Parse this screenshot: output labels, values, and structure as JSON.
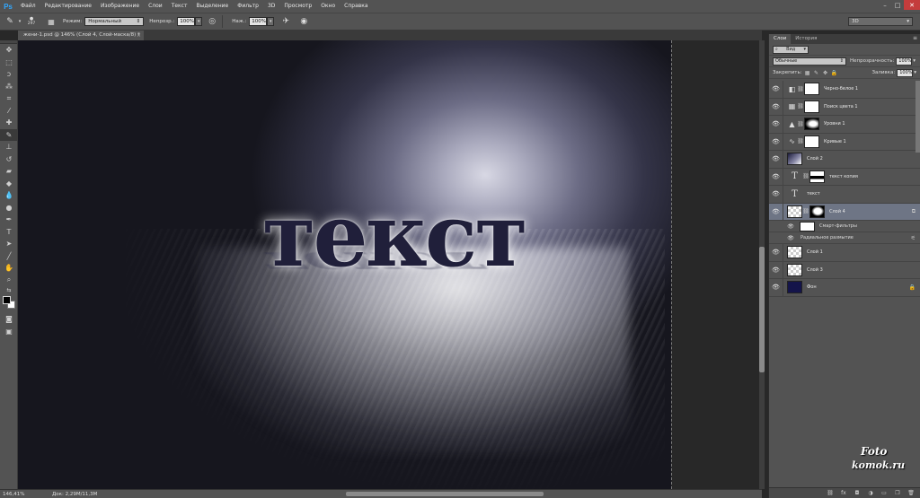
{
  "app": {
    "logo": "Ps",
    "menu": [
      "Файл",
      "Редактирование",
      "Изображение",
      "Слои",
      "Текст",
      "Выделение",
      "Фильтр",
      "3D",
      "Просмотр",
      "Окно",
      "Справка"
    ],
    "window_controls": [
      "–",
      "□",
      "✕"
    ]
  },
  "options": {
    "brush_size": "297",
    "mode_label": "Режим:",
    "mode_value": "Нормальный",
    "opacity_label": "Непрозр.:",
    "opacity_value": "100%",
    "flow_label": "Наж.:",
    "flow_value": "100%",
    "workspace": "3D"
  },
  "document": {
    "tab_title": "жени-1.psd @ 146% (Слой 4, Слой-маска/8) *",
    "close": "×"
  },
  "canvas": {
    "headline": "текст"
  },
  "status": {
    "zoom": "146,41%",
    "doc_info": "Док: 2,29M/11,3M"
  },
  "panel": {
    "tabs": [
      "Слои",
      "История"
    ],
    "filter_kind": "Вид",
    "blend_mode": "Обычные",
    "opacity_label": "Непрозрачность:",
    "opacity_value": "100%",
    "lock_label": "Закрепить:",
    "fill_label": "Заливка:",
    "fill_value": "100%",
    "layers": [
      {
        "name": "Черно-белое 1"
      },
      {
        "name": "Поиск цвета 1"
      },
      {
        "name": "Уровни 1"
      },
      {
        "name": "Кривые 1"
      },
      {
        "name": "Слой 2"
      },
      {
        "name": "текст копия"
      },
      {
        "name": "текст"
      },
      {
        "name": "Слой 4"
      },
      {
        "name": "Смарт-фильтры"
      },
      {
        "name": "Радиальное размытие"
      },
      {
        "name": "Слой 1"
      },
      {
        "name": "Слой 3"
      },
      {
        "name": "Фон"
      }
    ]
  },
  "watermark": {
    "line1": "Foto",
    "line2": "komok.ru"
  }
}
